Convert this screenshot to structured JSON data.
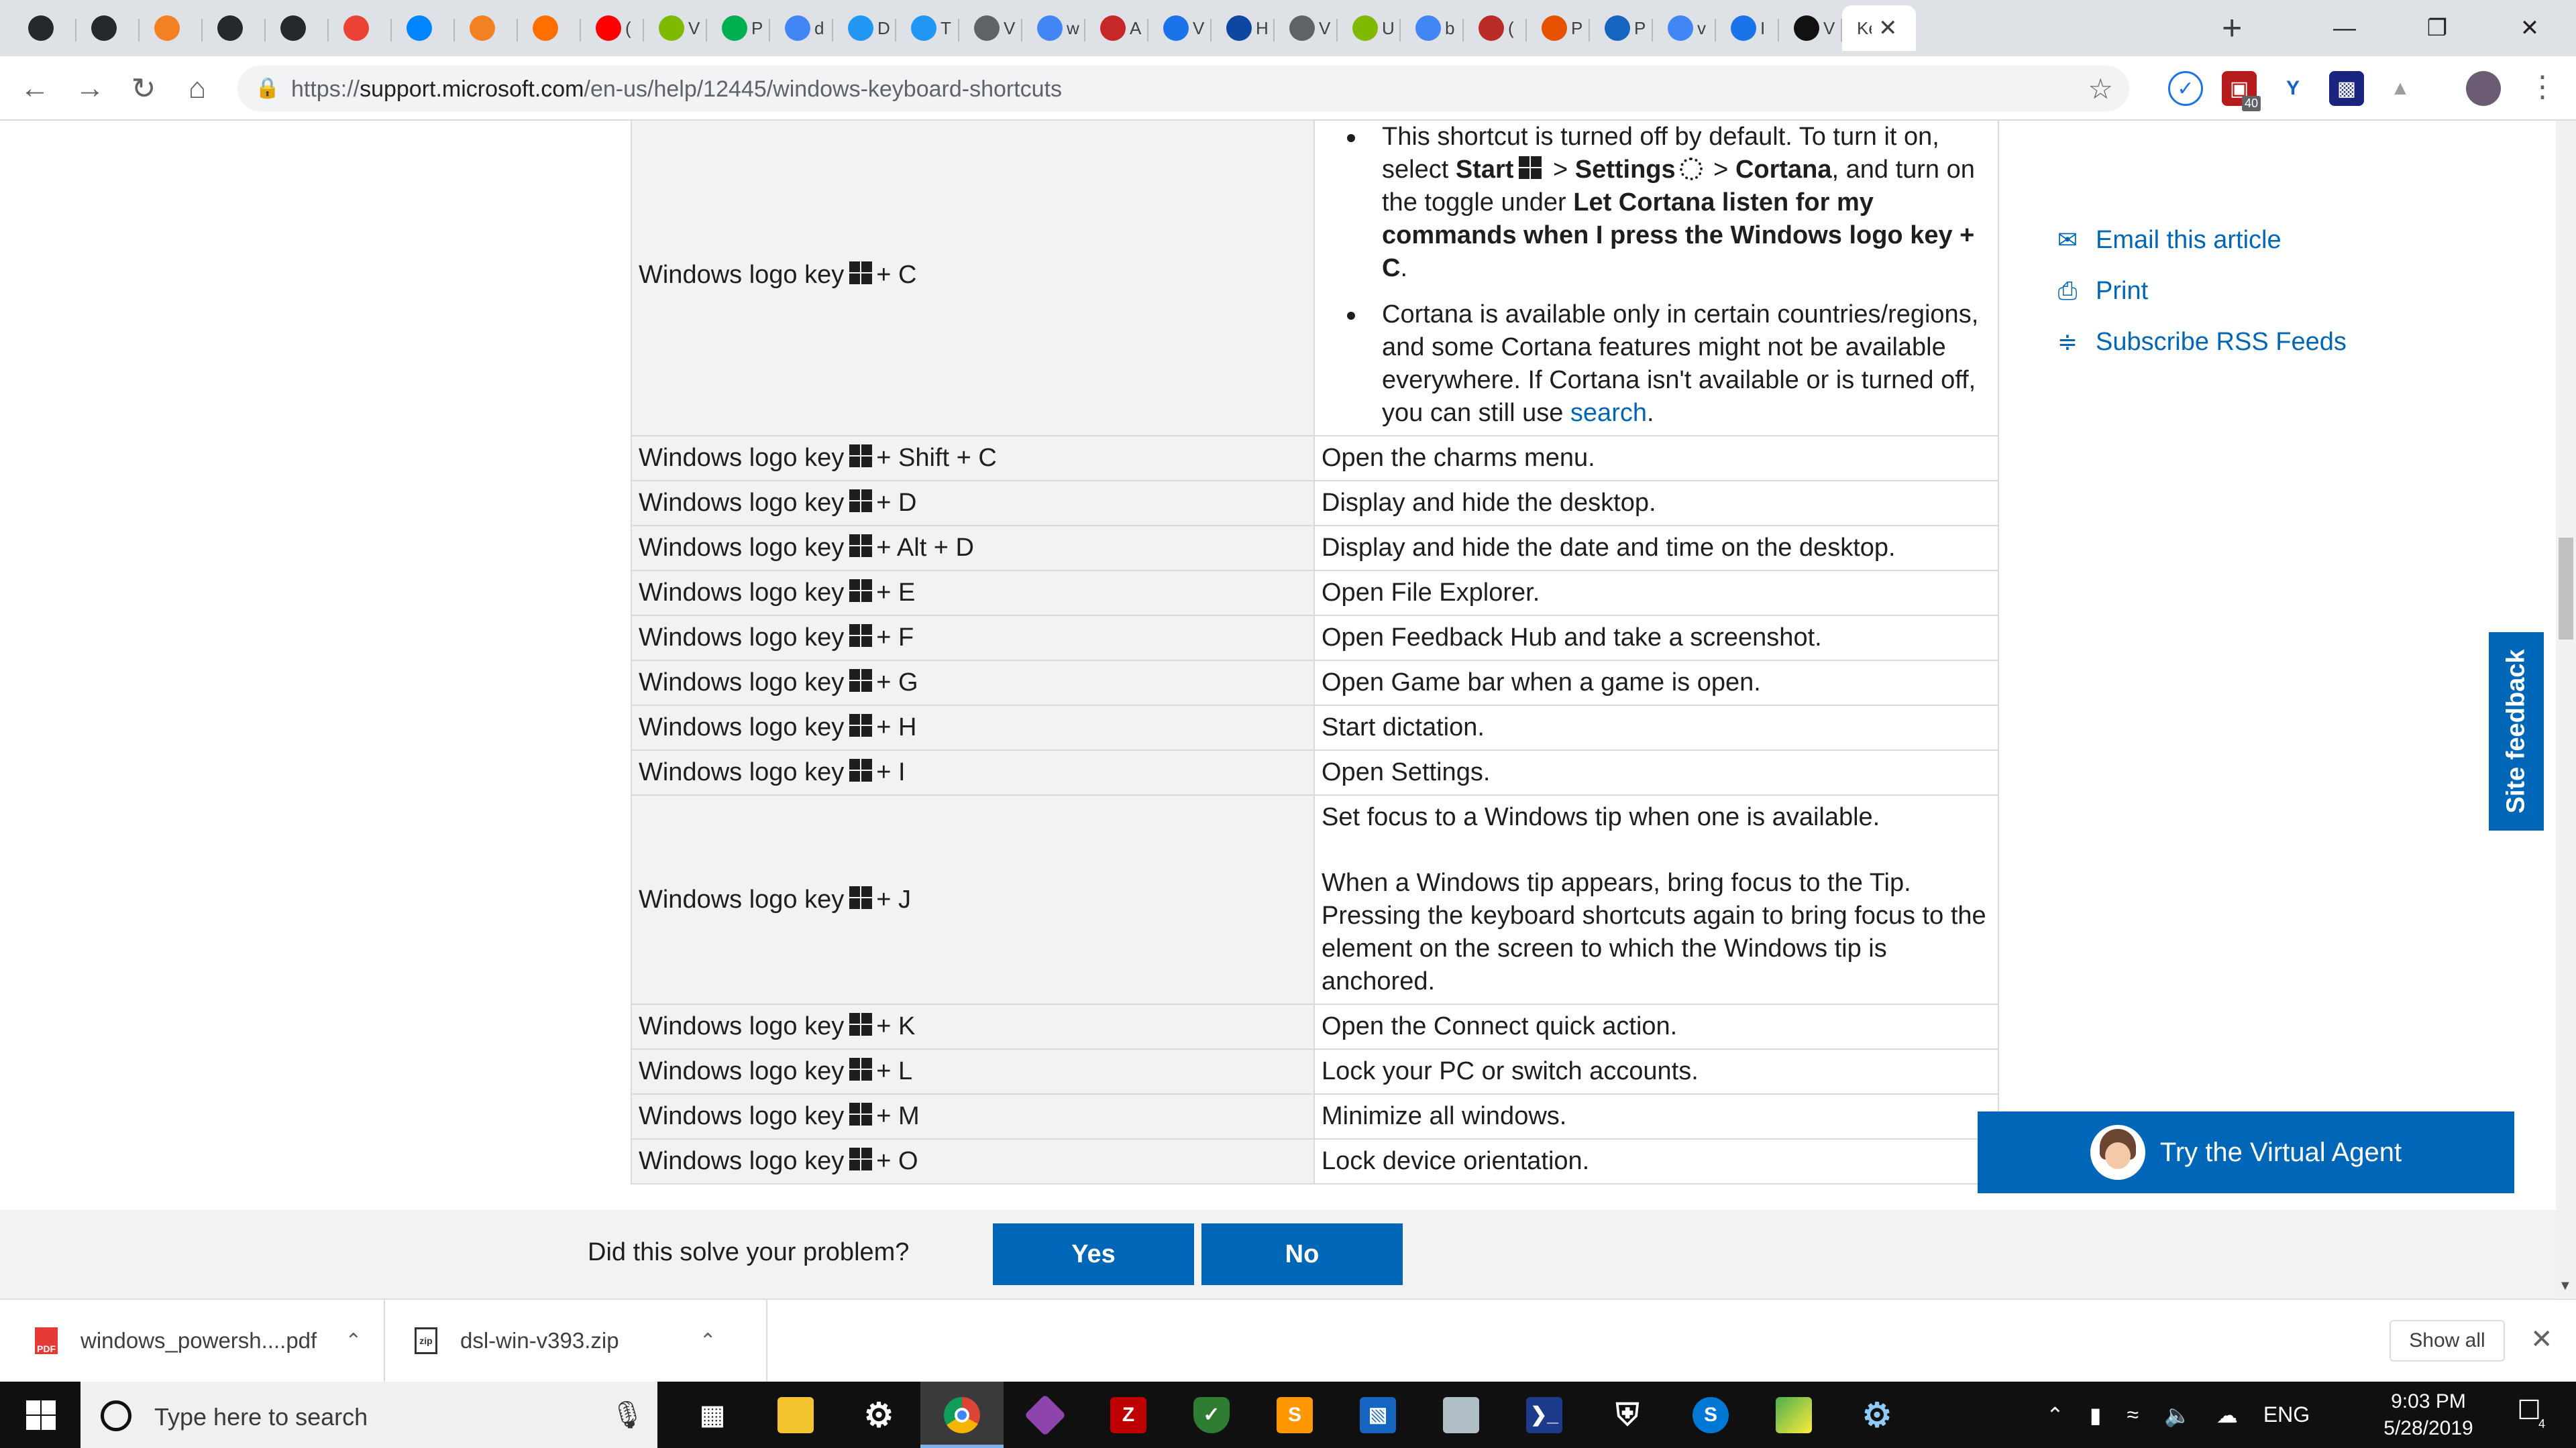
{
  "browser": {
    "tabs": [
      {
        "icon": "github-icon",
        "label": ""
      },
      {
        "icon": "github-icon",
        "label": ""
      },
      {
        "icon": "stackoverflow-icon",
        "label": ""
      },
      {
        "icon": "github-icon",
        "label": ""
      },
      {
        "icon": "github-icon",
        "label": ""
      },
      {
        "icon": "gmail-icon",
        "label": ""
      },
      {
        "icon": "messenger-icon",
        "label": ""
      },
      {
        "icon": "stackoverflow-icon",
        "label": ""
      },
      {
        "icon": "rainbow-icon",
        "label": ""
      },
      {
        "icon": "youtube-icon",
        "label": "("
      },
      {
        "icon": "microsoft-icon",
        "label": "V"
      },
      {
        "icon": "paint-icon",
        "label": "P"
      },
      {
        "icon": "google-icon",
        "label": "d"
      },
      {
        "icon": "s-icon",
        "label": "D"
      },
      {
        "icon": "s-icon",
        "label": "T"
      },
      {
        "icon": "globe-icon",
        "label": "V"
      },
      {
        "icon": "google-icon",
        "label": "w"
      },
      {
        "icon": "w-icon",
        "label": "A"
      },
      {
        "icon": "doc-icon",
        "label": "V"
      },
      {
        "icon": "faq-icon",
        "label": "H"
      },
      {
        "icon": "globe-icon",
        "label": "V"
      },
      {
        "icon": "microsoft-icon",
        "label": "U"
      },
      {
        "icon": "google-icon",
        "label": "b"
      },
      {
        "icon": "quora-icon",
        "label": "("
      },
      {
        "icon": "sp-icon",
        "label": "P"
      },
      {
        "icon": "itpro-icon",
        "label": "P"
      },
      {
        "icon": "google-icon",
        "label": "v"
      },
      {
        "icon": "doc-icon",
        "label": "I"
      },
      {
        "icon": "amazon-icon",
        "label": "V"
      },
      {
        "icon": "none",
        "label": "Ke",
        "active": true
      }
    ],
    "url_prefix": "https://",
    "url_host": "support.microsoft.com",
    "url_path": "/en-us/help/12445/windows-keyboard-shortcuts",
    "extension_badge": "40"
  },
  "article": {
    "rows": [
      {
        "key_prefix": "Windows logo key",
        "key_suffix": "+ C",
        "type": "cortana"
      },
      {
        "key_prefix": "Windows logo key",
        "key_suffix": "+ Shift + C",
        "desc": "Open the charms menu."
      },
      {
        "key_prefix": "Windows logo key",
        "key_suffix": "+ D",
        "desc": "Display and hide the desktop."
      },
      {
        "key_prefix": "Windows logo key",
        "key_suffix": "+ Alt + D",
        "desc": "Display and hide the date and time on the desktop."
      },
      {
        "key_prefix": "Windows logo key",
        "key_suffix": "+ E",
        "desc": "Open File Explorer."
      },
      {
        "key_prefix": "Windows logo key",
        "key_suffix": "+ F",
        "desc": "Open Feedback Hub and take a screenshot."
      },
      {
        "key_prefix": "Windows logo key",
        "key_suffix": "+ G",
        "desc": "Open Game bar when a game is open."
      },
      {
        "key_prefix": "Windows logo key",
        "key_suffix": "+ H",
        "desc": "Start dictation."
      },
      {
        "key_prefix": "Windows logo key",
        "key_suffix": "+ I",
        "desc": "Open Settings."
      },
      {
        "key_prefix": "Windows logo key",
        "key_suffix": "+ J",
        "type": "tip",
        "desc_line1": "Set focus to a Windows tip when one is available.",
        "desc_line2": "When a Windows tip appears, bring focus to the Tip.  Pressing the keyboard shortcuts again to bring focus to the element on the screen to which the Windows tip is anchored."
      },
      {
        "key_prefix": "Windows logo key",
        "key_suffix": "+ K",
        "desc": "Open the Connect quick action."
      },
      {
        "key_prefix": "Windows logo key",
        "key_suffix": "+ L",
        "desc": "Lock your PC or switch accounts."
      },
      {
        "key_prefix": "Windows logo key",
        "key_suffix": "+ M",
        "desc": "Minimize all windows."
      },
      {
        "key_prefix": "Windows logo key",
        "key_suffix": "+ O",
        "desc": "Lock device orientation."
      }
    ],
    "cortana": {
      "b1_text1": "This shortcut is turned off by default. To turn it on, select ",
      "b1_start": "Start",
      "b1_gt1": " > ",
      "b1_settings": "Settings",
      "b1_gt2": " > ",
      "b1_cortana": "Cortana",
      "b1_text2": ", and turn on the toggle under ",
      "b1_bold": "Let Cortana listen for my commands when I press the Windows logo key + C",
      "b1_end": ".",
      "b2_text": "Cortana is available only in certain countries/regions, and some Cortana features might not be available everywhere. If Cortana isn't available or is turned off, you can still use ",
      "b2_link": "search",
      "b2_end": "."
    }
  },
  "side_links": {
    "email": "Email this article",
    "print": "Print",
    "rss": "Subscribe RSS Feeds"
  },
  "site_feedback": "Site feedback",
  "virtual_agent": "Try the Virtual Agent",
  "feedback": {
    "question": "Did this solve your problem?",
    "yes": "Yes",
    "no": "No"
  },
  "downloads": {
    "items": [
      {
        "name": "windows_powersh....pdf",
        "icon": "pdf-icon"
      },
      {
        "name": "dsl-win-v393.zip",
        "icon": "zip-icon"
      }
    ],
    "show_all": "Show all"
  },
  "taskbar": {
    "search_placeholder": "Type here to search",
    "language": "ENG",
    "time": "9:03 PM",
    "date": "5/28/2019",
    "notification_count": "4"
  },
  "colors": {
    "accent": "#0067b8",
    "tabstrip": "#dee1e6",
    "taskbar": "#101010"
  }
}
